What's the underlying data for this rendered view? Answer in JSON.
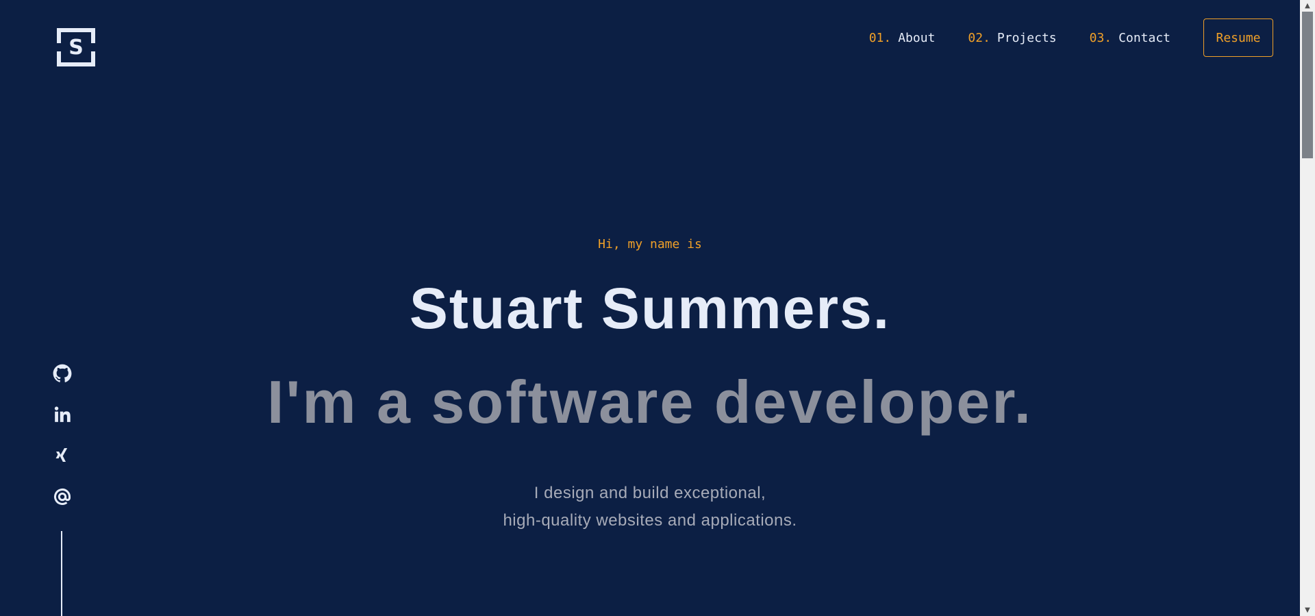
{
  "header": {
    "logo_letter": "S",
    "nav": [
      {
        "num": "01.",
        "label": "About"
      },
      {
        "num": "02.",
        "label": "Projects"
      },
      {
        "num": "03.",
        "label": "Contact"
      }
    ],
    "resume_label": "Resume"
  },
  "hero": {
    "greeting": "Hi, my name is",
    "name": "Stuart Summers.",
    "role": "I'm a software developer.",
    "description_line1": "I design and build exceptional,",
    "description_line2": "high-quality websites and applications."
  },
  "social": [
    {
      "icon": "github-icon"
    },
    {
      "icon": "linkedin-icon"
    },
    {
      "icon": "xing-icon"
    },
    {
      "icon": "email-at-icon"
    }
  ],
  "colors": {
    "background": "#0c1f44",
    "accent": "#f0a028",
    "text_primary": "#e6ecf8",
    "text_muted": "#8c909c"
  }
}
